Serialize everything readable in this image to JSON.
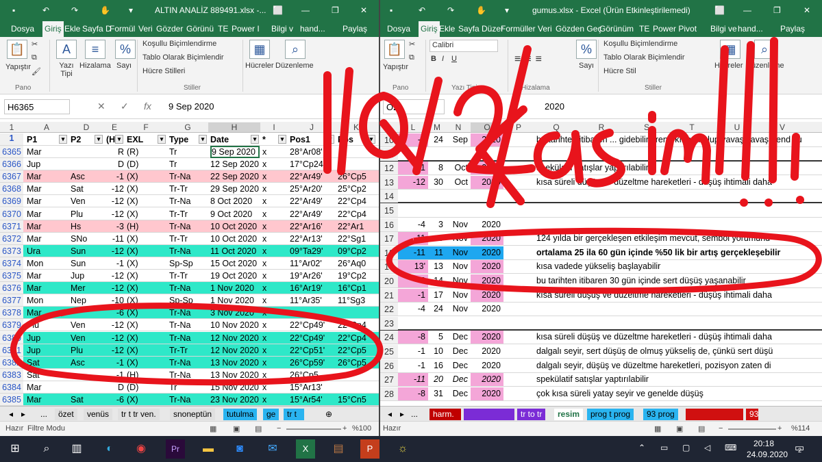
{
  "left": {
    "title": "ALTIN ANALİZ 889491.xlsx -...",
    "tabs": [
      "Dosya",
      "Giriş",
      "Ekle",
      "Sayfa D",
      "Formül",
      "Veri",
      "Gözder",
      "Görünü",
      "TE",
      "Power I",
      "Bilgi v",
      "hand...",
      "Paylaş"
    ],
    "ribbon": {
      "paste": "Yapıştır",
      "font": "Yazı Tipi",
      "align": "Hizalama",
      "number": "Sayı",
      "cond": "Koşullu Biçimlendirme",
      "table": "Tablo Olarak Biçimlendir",
      "cell_styles": "Hücre Stilleri",
      "cells": "Hücreler",
      "edit": "Düzenleme",
      "grp_clip": "Pano",
      "grp_styles": "Stiller"
    },
    "namebox": "H6365",
    "formula": "9 Sep 2020",
    "col_letters": [
      "A",
      "D",
      "E",
      "F",
      "G",
      "H",
      "I",
      "J",
      "K"
    ],
    "headers": [
      "P1",
      "P2",
      "(H",
      "EXL",
      "Type",
      "Date",
      "*",
      "Pos1",
      "Pos"
    ],
    "rows": [
      [
        "6365",
        "Mar",
        "",
        "R",
        "(R)",
        "Tr",
        "9 Sep 2020",
        "x",
        "28°Ar08'",
        ""
      ],
      [
        "6366",
        "Jup",
        "",
        "D",
        "(D)",
        "Tr",
        "12 Sep 2020",
        "x",
        "17°Cp24'",
        ""
      ],
      [
        "6367",
        "Mar",
        "Asc",
        "-1",
        "(X)",
        "Tr-Na",
        "22 Sep 2020",
        "x",
        "22°Ar49'",
        "26°Cp5"
      ],
      [
        "6368",
        "Mar",
        "Sat",
        "-12",
        "(X)",
        "Tr-Tr",
        "29 Sep 2020",
        "x",
        "25°Ar20'",
        "25°Cp2"
      ],
      [
        "6369",
        "Mar",
        "Ven",
        "-12",
        "(X)",
        "Tr-Na",
        "8 Oct 2020",
        "x",
        "22°Ar49'",
        "22°Cp4"
      ],
      [
        "6370",
        "Mar",
        "Plu",
        "-12",
        "(X)",
        "Tr-Tr",
        "9 Oct 2020",
        "x",
        "22°Ar49'",
        "22°Cp4"
      ],
      [
        "6371",
        "Mar",
        "Hs",
        "-3",
        "(H)",
        "Tr-Na",
        "10 Oct 2020",
        "x",
        "22°Ar16'",
        "22°Ar1"
      ],
      [
        "6372",
        "Mar",
        "SNo",
        "-11",
        "(X)",
        "Tr-Tr",
        "10 Oct 2020",
        "x",
        "22°Ar13'",
        "22°Sg1"
      ],
      [
        "6373",
        "Ura",
        "Sun",
        "-12",
        "(X)",
        "Tr-Na",
        "11 Oct 2020",
        "x",
        "09°Ta29'",
        "09°Cp2"
      ],
      [
        "6374",
        "Mon",
        "Sun",
        "-1",
        "(X)",
        "Sp-Sp",
        "15 Oct 2020",
        "x",
        "11°Ar02'",
        "26°Aq0"
      ],
      [
        "6375",
        "Mar",
        "Jup",
        "-12",
        "(X)",
        "Tr-Tr",
        "19 Oct 2020",
        "x",
        "19°Ar26'",
        "19°Cp2"
      ],
      [
        "6376",
        "Mar",
        "Mer",
        "-12",
        "(X)",
        "Tr-Na",
        "1 Nov 2020",
        "x",
        "16°Ar19'",
        "16°Cp1"
      ],
      [
        "6377",
        "Mon",
        "Nep",
        "-10",
        "(X)",
        "Sp-Sp",
        "1 Nov 2020",
        "x",
        "11°Ar35'",
        "11°Sg3"
      ],
      [
        "6378",
        "Mar",
        "",
        "-6",
        "(X)",
        "Tr-Na",
        "3 Nov 2020",
        "x",
        "",
        ""
      ],
      [
        "6379",
        "Plu",
        "Ven",
        "-12",
        "(X)",
        "Tr-Na",
        "10 Nov 2020",
        "x",
        "22°Cp49'",
        "22°Cp4"
      ],
      [
        "6380",
        "Jup",
        "Ven",
        "-12",
        "(X)",
        "Tr-Na",
        "12 Nov 2020",
        "x",
        "22°Cp49'",
        "22°Cp4"
      ],
      [
        "6381",
        "Jup",
        "Plu",
        "-12",
        "(X)",
        "Tr-Tr",
        "12 Nov 2020",
        "x",
        "22°Cp51'",
        "22°Cp5"
      ],
      [
        "6382",
        "Sat",
        "Asc",
        "-1",
        "(X)",
        "Tr-Na",
        "13 Nov 2020",
        "x",
        "26°Cp59'",
        "26°Cp5"
      ],
      [
        "6383",
        "Sat",
        "",
        "-1",
        "(H)",
        "Tr-Na",
        "13 Nov 2020",
        "x",
        "26°Cp5",
        ""
      ],
      [
        "6384",
        "Mar",
        "",
        "D",
        "(D)",
        "Tr",
        "15 Nov 2020",
        "x",
        "15°Ar13'",
        ""
      ],
      [
        "6385",
        "Mar",
        "Sat",
        "-6",
        "(X)",
        "Tr-Na",
        "23 Nov 2020",
        "x",
        "15°Ar54'",
        "15°Cn5"
      ]
    ],
    "sheets": [
      "...",
      "özet",
      "venüs",
      "tr t tr ven.",
      "snoneptün",
      "tutulma",
      "ge",
      "tr t"
    ],
    "status": {
      "ready": "Hazır",
      "mode": "Filtre Modu",
      "zoom": "%100"
    }
  },
  "right": {
    "title": "gumus.xlsx - Excel (Ürün Etkinleştirilemedi)",
    "tabs": [
      "Dosya",
      "Giriş",
      "Ekle",
      "Sayfa Düzer",
      "Formüller",
      "Veri",
      "Gözden Geç",
      "Görünüm",
      "TE",
      "Power Pivot",
      "Bilgi ve",
      "hand...",
      "Paylaş"
    ],
    "ribbon": {
      "paste": "Yapıştır",
      "font": "Calibri",
      "font_group": "Yazı Tipi",
      "align": "Hizalama",
      "number": "Sayı",
      "cond": "Koşullu Biçimlendirme",
      "table": "Tablo Olarak Biçimlendir",
      "cell_styles": "Hücre Stil",
      "cells": "Hücreler",
      "edit": "Düzenleme",
      "grp_clip": "Pano",
      "grp_styles": "Stiller"
    },
    "namebox": "O2",
    "formula": "2020",
    "col_letters": [
      "L",
      "M",
      "N",
      "O",
      "P",
      "Q",
      "R",
      "S",
      "T",
      "U",
      "V"
    ],
    "rows": [
      [
        "10",
        "-1",
        "24",
        "Sep",
        "2020",
        "bu tarihten itibaren ... gidebilir, trend kırılımı olup yavaş yavaş trend yu"
      ],
      [
        "11",
        "",
        "",
        "",
        "",
        ""
      ],
      [
        "12",
        "-11",
        "8",
        "Oct",
        "2020",
        "spekülatif satışlar yaptırılabilir"
      ],
      [
        "13",
        "-12",
        "30",
        "Oct",
        "2020",
        "kısa süreli düşüş ve düzeltme hareketleri - düşüş ihtimali daha"
      ],
      [
        "14",
        "",
        "",
        "",
        "",
        ""
      ],
      [
        "15",
        "",
        "",
        "",
        "",
        ""
      ],
      [
        "16",
        "-4",
        "3",
        "Nov",
        "2020",
        ""
      ],
      [
        "17",
        "-11",
        "3",
        "Nov",
        "2020",
        "124 yılda bir gerçekleşen etkileşim mevcut, sembol yorumund"
      ],
      [
        "18",
        "-11",
        "11",
        "Nov",
        "2020",
        "ortalama 25 ila 60 gün içinde %50 lik bir artış gerçekleşebilir"
      ],
      [
        "19",
        "13'",
        "13",
        "Nov",
        "2020",
        "kısa vadede yükseliş başlayabilir"
      ],
      [
        "20",
        "-8",
        "14",
        "Nov",
        "2020",
        "bu tarihten itibaren 30 gün içinde sert düşüş yaşanabilir"
      ],
      [
        "21",
        "-1",
        "17",
        "Nov",
        "2020",
        "kısa süreli düşüş ve düzeltme hareketleri - düşüş ihtimali daha"
      ],
      [
        "22",
        "-4",
        "24",
        "Nov",
        "2020",
        ""
      ],
      [
        "23",
        "",
        "",
        "",
        "",
        ""
      ],
      [
        "24",
        "-8",
        "5",
        "Dec",
        "2020",
        "kısa süreli düşüş ve düzeltme hareketleri - düşüş ihtimali daha"
      ],
      [
        "25",
        "-1",
        "10",
        "Dec",
        "2020",
        "dalgalı seyir, sert düşüş de olmuş yükseliş de, çünkü sert düşü"
      ],
      [
        "26",
        "-1",
        "16",
        "Dec",
        "2020",
        "dalgalı seyir, düşüş ve düzeltme hareketleri, pozisyon zaten di"
      ],
      [
        "27",
        "-11",
        "20",
        "Dec",
        "2020",
        "spekülatif satışlar yaptırılabilir"
      ],
      [
        "28",
        "-8",
        "31",
        "Dec",
        "2020",
        "çok kısa süreli yatay seyir ve genelde düşüş"
      ]
    ],
    "sheets": [
      "...",
      "harm.",
      "",
      "tr to tr",
      "resim",
      "prog t prog",
      "93 prog",
      "",
      "93"
    ],
    "status": {
      "ready": "Hazır",
      "zoom": "%114"
    }
  },
  "annotation": {
    "ink_text": "11 - 12 Kasım !!!",
    "ink_color": "#e8141c"
  },
  "taskbar": {
    "time": "20:18",
    "date": "24.09.2020",
    "notif": "2"
  },
  "colors": {
    "excel_green": "#217346",
    "pink": "#ffc7ce",
    "teal": "#2ee8c8",
    "pink2": "#f4a6d8",
    "blue_sel": "#1ea7f0",
    "purple": "#7b2cd6"
  }
}
